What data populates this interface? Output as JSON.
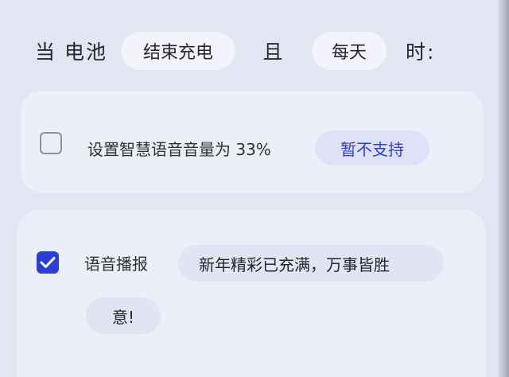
{
  "condition": {
    "prefix": "当 电池",
    "trigger_chip": "结束充电",
    "conjunction": "且",
    "schedule_chip": "每天",
    "suffix": "时:"
  },
  "actions": [
    {
      "checked": false,
      "label": "设置智慧语音音量为 33%",
      "value": "暂不支持"
    },
    {
      "checked": true,
      "label": "语音播报",
      "value_line1": "新年精彩已充满，万事皆胜",
      "value_line2": "意!"
    }
  ],
  "colors": {
    "accent": "#2b3fd3",
    "background": "#e4e5f3",
    "card": "#eceefa"
  }
}
